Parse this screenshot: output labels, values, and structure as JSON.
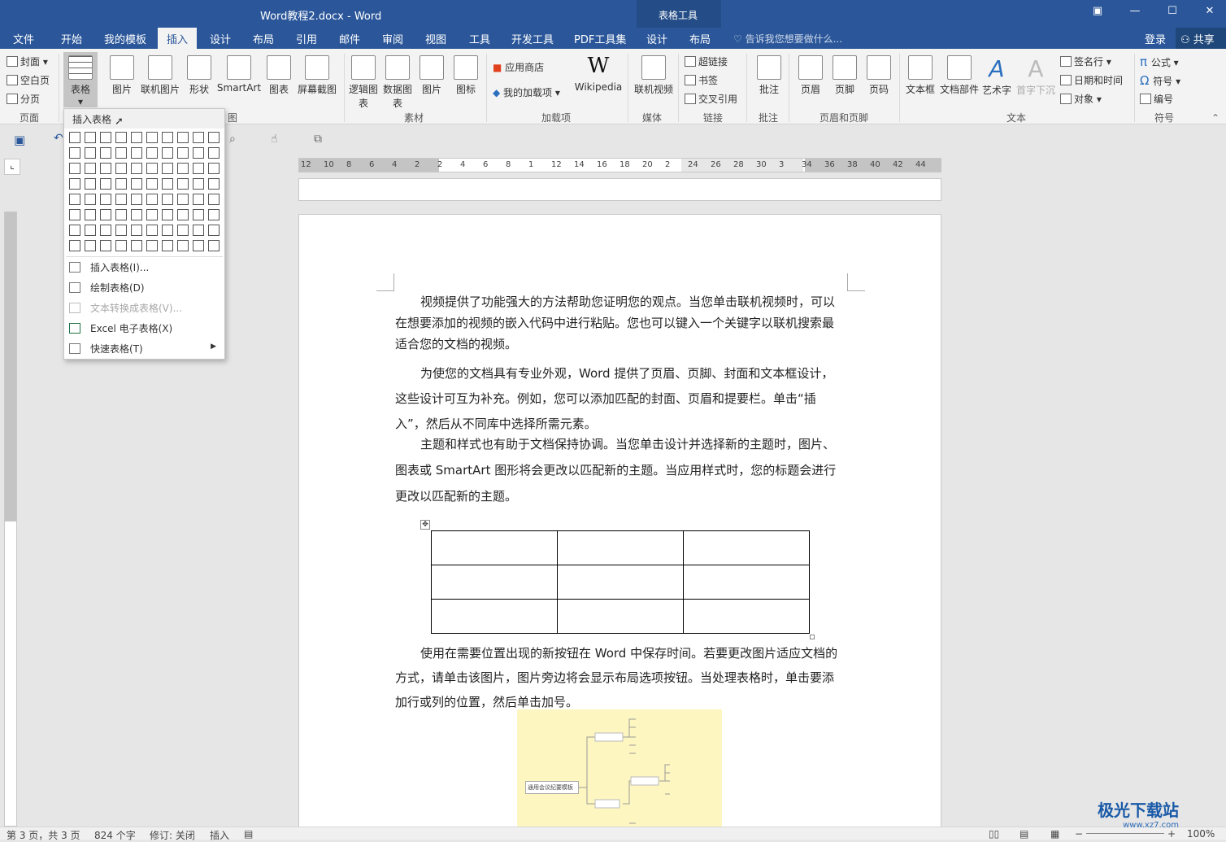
{
  "window": {
    "title": "Word教程2.docx - Word",
    "context_tab_group": "表格工具"
  },
  "tabs": [
    {
      "label": "文件"
    },
    {
      "label": "开始"
    },
    {
      "label": "我的模板"
    },
    {
      "label": "插入"
    },
    {
      "label": "设计"
    },
    {
      "label": "布局"
    },
    {
      "label": "引用"
    },
    {
      "label": "邮件"
    },
    {
      "label": "审阅"
    },
    {
      "label": "视图"
    },
    {
      "label": "工具"
    },
    {
      "label": "开发工具"
    },
    {
      "label": "PDF工具集"
    },
    {
      "label": "设计"
    },
    {
      "label": "布局"
    }
  ],
  "active_tab": "插入",
  "tell_me": "告诉我您想要做什么...",
  "login": "登录",
  "share": "共享",
  "ribbon": {
    "page_group": {
      "label": "页面",
      "items": [
        "封面",
        "空白页",
        "分页"
      ]
    },
    "table_button": "表格",
    "illustrations": [
      "图片",
      "联机图片",
      "形状",
      "SmartArt",
      "图表",
      "屏幕截图"
    ],
    "illustrations_label_fragment": "图",
    "material": {
      "label": "素材",
      "items": [
        "逻辑图表",
        "数据图表",
        "图片",
        "图标"
      ]
    },
    "addins": {
      "label": "加载项",
      "store": "应用商店",
      "my_addins": "我的加载项",
      "wikipedia": "Wikipedia"
    },
    "media": {
      "label": "媒体",
      "item": "联机视频"
    },
    "links": {
      "label": "链接",
      "items": [
        "超链接",
        "书签",
        "交叉引用"
      ]
    },
    "comments": {
      "label": "批注",
      "item": "批注"
    },
    "header_footer": {
      "label": "页眉和页脚",
      "items": [
        "页眉",
        "页脚",
        "页码"
      ]
    },
    "text": {
      "label": "文本",
      "items": [
        "文本框",
        "文档部件",
        "艺术字",
        "首字下沉"
      ],
      "small": [
        "签名行",
        "日期和时间",
        "对象"
      ]
    },
    "symbols": {
      "label": "符号",
      "items": [
        "公式",
        "符号",
        "编号"
      ]
    }
  },
  "dropdown": {
    "header": "插入表格",
    "grid_cols": 10,
    "grid_rows": 8,
    "items": [
      {
        "label": "插入表格(I)...",
        "disabled": false
      },
      {
        "label": "绘制表格(D)",
        "disabled": false
      },
      {
        "label": "文本转换成表格(V)...",
        "disabled": true
      },
      {
        "label": "Excel 电子表格(X)",
        "disabled": false
      },
      {
        "label": "快速表格(T)",
        "disabled": false
      }
    ]
  },
  "ruler": {
    "ticks": [
      "12",
      "10",
      "8",
      "6",
      "4",
      "2",
      "2",
      "4",
      "6",
      "8",
      "1",
      "12",
      "14",
      "16",
      "18",
      "20",
      "2",
      "24",
      "26",
      "28",
      "30",
      "3",
      "34",
      "36",
      "38",
      "40",
      "42",
      "44"
    ]
  },
  "document": {
    "paragraphs": [
      "视频提供了功能强大的方法帮助您证明您的观点。当您单击联机视频时，可以在想要添加的视频的嵌入代码中进行粘贴。您也可以键入一个关键字以联机搜索最适合您的文档的视频。",
      "为使您的文档具有专业外观，Word 提供了页眉、页脚、封面和文本框设计，这些设计可互为补充。例如，您可以添加匹配的封面、页眉和提要栏。单击“插入”，然后从不同库中选择所需元素。",
      "主题和样式也有助于文档保持协调。当您单击设计并选择新的主题时，图片、图表或 SmartArt 图形将会更改以匹配新的主题。当应用样式时，您的标题会进行更改以匹配新的主题。",
      "使用在需要位置出现的新按钮在 Word 中保存时间。若要更改图片适应文档的方式，请单击该图片，图片旁边将会显示布局选项按钮。当处理表格时，单击要添加行或列的位置，然后单击加号。"
    ],
    "table": {
      "rows": 3,
      "cols": 3
    },
    "mindmap_center": "通用会议纪要模板"
  },
  "status": {
    "page": "第 3 页，共 3 页",
    "words": "824 个字",
    "track": "修订: 关闭",
    "mode": "插入",
    "zoom": "100%"
  },
  "watermark": {
    "text": "极光下载站",
    "url": "www.xz7.com"
  },
  "colors": {
    "title_bar": "#2b579a",
    "ribbon": "#f3f3f3",
    "accent": "#2b579a"
  }
}
